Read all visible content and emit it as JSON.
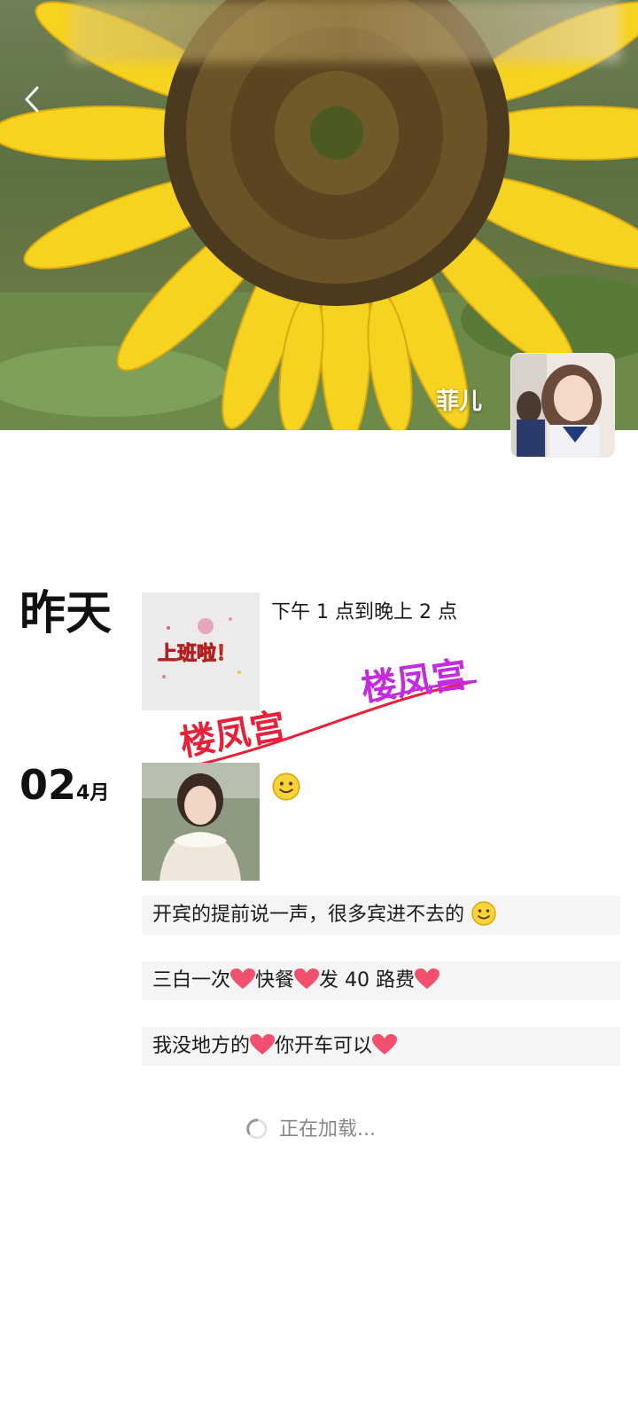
{
  "profile": {
    "nickname": "菲儿"
  },
  "header": {
    "back_icon": "chevron-left-icon"
  },
  "posts": [
    {
      "day_label": "昨天",
      "text": "下午 1 点到晚上 2 点",
      "image_caption": "上班啦！"
    },
    {
      "day": "02",
      "month": "4月",
      "emoji": "smiley-emoji",
      "messages": [
        {
          "before": "开宾的提前说一声，很多宾进不去的"
        },
        {
          "seg1": "三白一次",
          "seg2": "快餐",
          "seg3": "发 40 路费"
        },
        {
          "seg1": "我没地方的",
          "seg2": "你开车可以"
        }
      ]
    }
  ],
  "watermark": {
    "left": "楼凤宫",
    "right": "楼凤宫"
  },
  "loading": {
    "text": "正在加载..."
  },
  "colors": {
    "accent_red": "#e8203a",
    "accent_purple": "#c42adf",
    "heart": "#f0506e",
    "sunflower_yellow": "#f6d320"
  }
}
